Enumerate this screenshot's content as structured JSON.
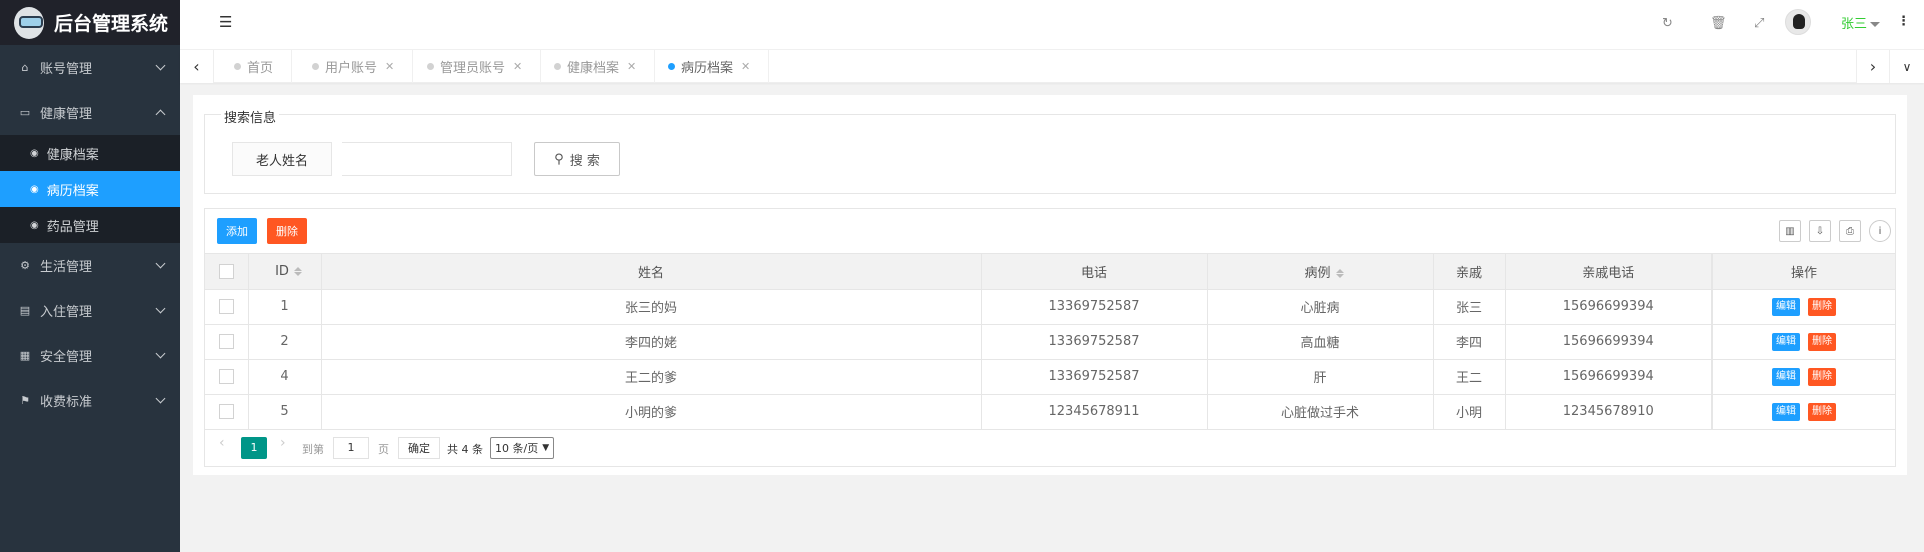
{
  "app": {
    "title": "后台管理系统"
  },
  "sidebar": {
    "items": [
      {
        "label": "账号管理",
        "icon": "home-icon",
        "expanded": false
      },
      {
        "label": "健康管理",
        "icon": "window-icon",
        "expanded": true
      },
      {
        "label": "生活管理",
        "icon": "gears-icon",
        "expanded": false
      },
      {
        "label": "入住管理",
        "icon": "file-icon",
        "expanded": false
      },
      {
        "label": "安全管理",
        "icon": "calendar-icon",
        "expanded": false
      },
      {
        "label": "收费标准",
        "icon": "flag-icon",
        "expanded": false
      }
    ],
    "sub_items": [
      {
        "label": "健康档案",
        "icon": "dashboard-icon",
        "active": false
      },
      {
        "label": "病历档案",
        "icon": "dashboard-icon",
        "active": true
      },
      {
        "label": "药品管理",
        "icon": "dashboard-icon",
        "active": false
      }
    ]
  },
  "header": {
    "user_name": "张三"
  },
  "tabs": [
    {
      "label": "首页",
      "closable": false
    },
    {
      "label": "用户账号",
      "closable": true
    },
    {
      "label": "管理员账号",
      "closable": true
    },
    {
      "label": "健康档案",
      "closable": true
    },
    {
      "label": "病历档案",
      "closable": true,
      "active": true
    }
  ],
  "search": {
    "legend": "搜索信息",
    "label": "老人姓名",
    "value": "",
    "button": "搜 索"
  },
  "toolbar": {
    "add_label": "添加",
    "delete_label": "删除"
  },
  "table": {
    "columns": [
      "ID",
      "姓名",
      "电话",
      "病例",
      "亲戚",
      "亲戚电话",
      "操作"
    ],
    "rows": [
      {
        "id": "1",
        "name": "张三的妈",
        "phone": "13369752587",
        "case": "心脏病",
        "relative": "张三",
        "relative_phone": "15696699394"
      },
      {
        "id": "2",
        "name": "李四的姥",
        "phone": "13369752587",
        "case": "高血糖",
        "relative": "李四",
        "relative_phone": "15696699394"
      },
      {
        "id": "4",
        "name": "王二的爹",
        "phone": "13369752587",
        "case": "肝",
        "relative": "王二",
        "relative_phone": "15696699394"
      },
      {
        "id": "5",
        "name": "小明的爹",
        "phone": "12345678911",
        "case": "心脏做过手术",
        "relative": "小明",
        "relative_phone": "12345678910"
      }
    ],
    "edit_label": "编辑",
    "delete_label": "删除"
  },
  "pager": {
    "current": "1",
    "goto_prefix": "到第",
    "goto_value": "1",
    "goto_suffix": "页",
    "confirm": "确定",
    "total": "共 4 条",
    "page_size": "10 条/页"
  },
  "colors": {
    "sidebar": "#28333e",
    "accent": "#1e9fff",
    "danger": "#ff5722",
    "pager_active": "#009688",
    "user_name": "#32cd32"
  }
}
